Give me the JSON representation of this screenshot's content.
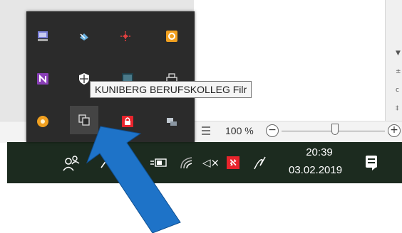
{
  "tooltip": {
    "text": "KUNIBERG BERUFSKOLLEG Filr"
  },
  "word_status": {
    "zoom": "100 %",
    "zoom_minus": "−",
    "zoom_plus": "+"
  },
  "taskbar": {
    "time": "20:39",
    "date": "03.02.2019"
  },
  "tray_icons": [
    {
      "name": "network-drive-icon",
      "color": "#7a7fd8"
    },
    {
      "name": "network-share-icon",
      "color": "#6ab0de"
    },
    {
      "name": "remote-connection-icon",
      "color": "#e04040"
    },
    {
      "name": "outlook-icon",
      "color": "#f0a020"
    },
    {
      "name": "onenote-icon",
      "color": "#8a3fb8"
    },
    {
      "name": "windows-security-icon",
      "color": "#ffffff"
    },
    {
      "name": "display-app-icon",
      "color": "#4a7a8a"
    },
    {
      "name": "printer-icon",
      "color": "#dddddd"
    },
    {
      "name": "coin-app-icon",
      "color": "#f0a020"
    },
    {
      "name": "filr-sync-icon",
      "color": "#dddddd"
    },
    {
      "name": "lock-app-icon",
      "color": "#e8242c"
    },
    {
      "name": "device-transfer-icon",
      "color": "#c0c8d0"
    }
  ],
  "accent": {
    "arrow": "#1e73c8",
    "taskbar": "#1c2b1f"
  }
}
